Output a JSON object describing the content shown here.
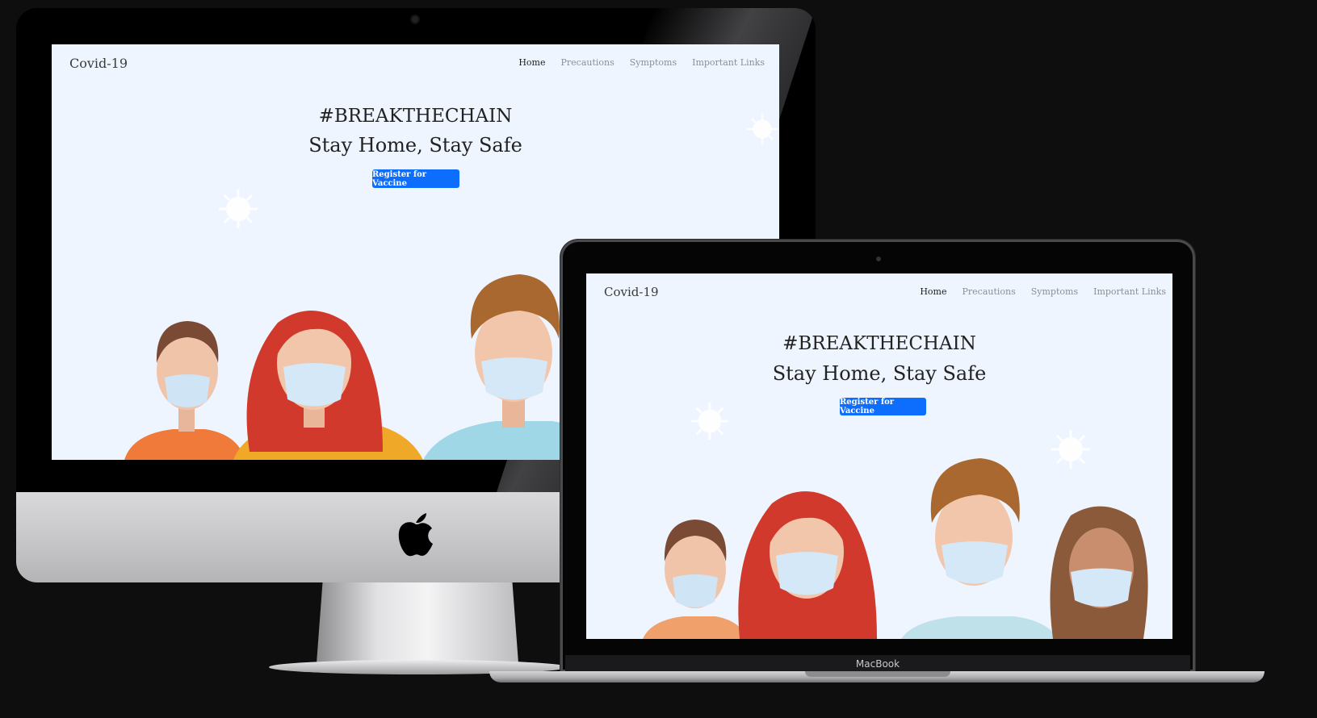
{
  "desktop_site": {
    "brand": "Covid-19",
    "nav": [
      {
        "label": "Home",
        "active": true
      },
      {
        "label": "Precautions",
        "active": false
      },
      {
        "label": "Symptoms",
        "active": false
      },
      {
        "label": "Important Links",
        "active": false
      }
    ],
    "headline": "#BREAKTHECHAIN",
    "subheadline": "Stay Home, Stay Safe",
    "cta_label": "Register for Vaccine"
  },
  "laptop_site": {
    "brand": "Covid-19",
    "nav": [
      {
        "label": "Home",
        "active": true
      },
      {
        "label": "Precautions",
        "active": false
      },
      {
        "label": "Symptoms",
        "active": false
      },
      {
        "label": "Important Links",
        "active": false
      }
    ],
    "headline": "#BREAKTHECHAIN",
    "subheadline": "Stay Home, Stay Safe",
    "cta_label": "Register for Vaccine"
  },
  "laptop_label": "MacBook",
  "colors": {
    "screen_bg": "#eef5ff",
    "button": "#0d6efd",
    "background": "#0e0e0f"
  },
  "icons": [
    "apple-logo-icon",
    "virus-icon"
  ]
}
